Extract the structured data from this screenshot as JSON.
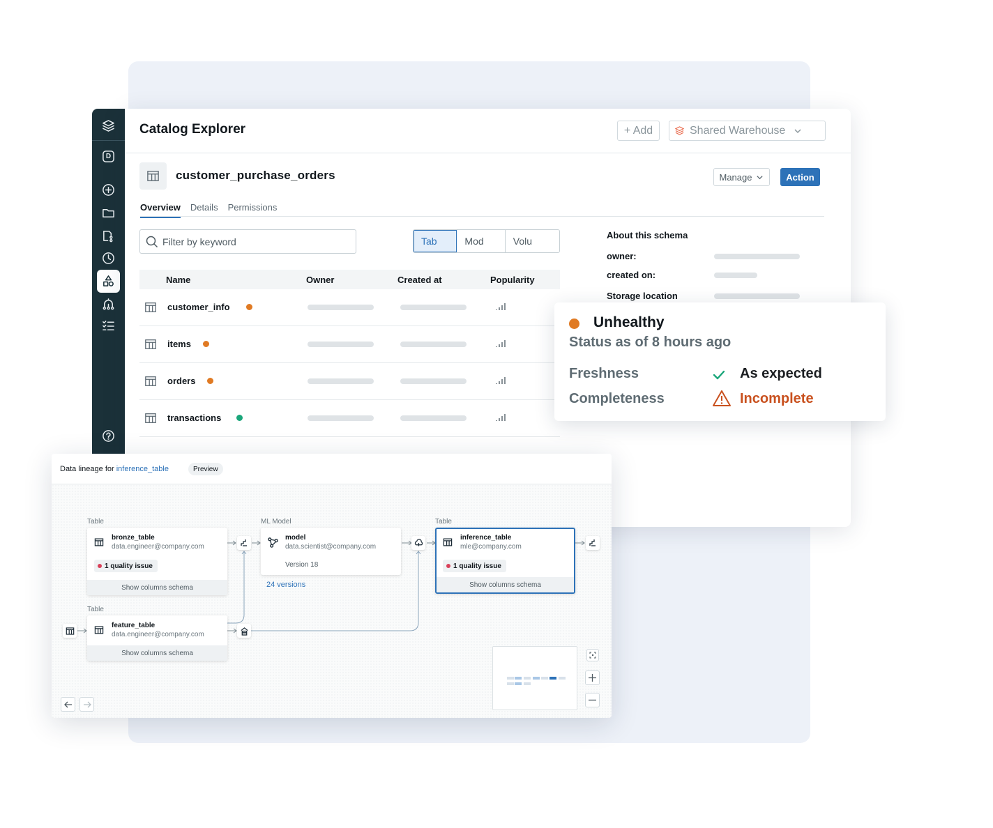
{
  "sidebar": {
    "icons": [
      "layers-icon",
      "workspace-d-icon",
      "plus-circle-icon",
      "folder-icon",
      "repo-icon",
      "history-icon",
      "catalog-shapes-icon",
      "workflows-icon",
      "tasks-icon",
      "help-icon"
    ],
    "workspace_letter": "D",
    "active": "catalog-shapes-icon"
  },
  "catalog": {
    "title": "Catalog Explorer",
    "add_label": "+ Add",
    "warehouse": "Shared Warehouse",
    "object_name": "customer_purchase_orders",
    "manage_label": "Manage",
    "action_label": "Action",
    "tabs": [
      {
        "label": "Overview",
        "active": true
      },
      {
        "label": "Details",
        "active": false
      },
      {
        "label": "Permissions",
        "active": false
      }
    ],
    "filter_placeholder": "Filter by keyword",
    "segments": [
      {
        "label": "Tab",
        "active": true
      },
      {
        "label": "Mod",
        "active": false
      },
      {
        "label": "Volu",
        "active": false
      }
    ],
    "columns": [
      "Name",
      "Owner",
      "Created at",
      "Popularity"
    ],
    "rows": [
      {
        "name": "customer_info",
        "status": "orange"
      },
      {
        "name": "items",
        "status": "orange"
      },
      {
        "name": "orders",
        "status": "orange"
      },
      {
        "name": "transactions",
        "status": "green"
      }
    ],
    "about": {
      "title": "About this schema",
      "owner_label": "owner:",
      "created_label": "created on:",
      "storage_label": "Storage location"
    }
  },
  "health": {
    "status": "Unhealthy",
    "subtitle": "Status as of 8 hours ago",
    "metrics": [
      {
        "label": "Freshness",
        "value": "As expected",
        "icon": "check-icon",
        "color": "#1b1e21"
      },
      {
        "label": "Completeness",
        "value": "Incomplete",
        "icon": "warning-icon",
        "color": "#c9511f"
      }
    ]
  },
  "lineage": {
    "title_prefix": "Data lineage for ",
    "title_link": "inference_table",
    "badge": "Preview",
    "nodes": {
      "bronze": {
        "type_label": "Table",
        "name": "bronze_table",
        "owner": "data.engineer@company.com",
        "issue": "1 quality issue",
        "footer": "Show columns schema"
      },
      "feature": {
        "type_label": "Table",
        "name": "feature_table",
        "owner": "data.engineer@company.com",
        "footer": "Show columns schema"
      },
      "model": {
        "type_label": "ML Model",
        "name": "model",
        "owner": "data.scientist@company.com",
        "version": "Version 18",
        "versions_link": "24 versions"
      },
      "inference": {
        "type_label": "Table",
        "name": "inference_table",
        "owner": "mle@company.com",
        "issue": "1 quality issue",
        "footer": "Show columns schema"
      }
    }
  },
  "colors": {
    "accent": "#2d72b8",
    "sidebar": "#1b3139",
    "orange": "#e07a23",
    "green": "#1aa67a",
    "warning": "#c9511f"
  }
}
